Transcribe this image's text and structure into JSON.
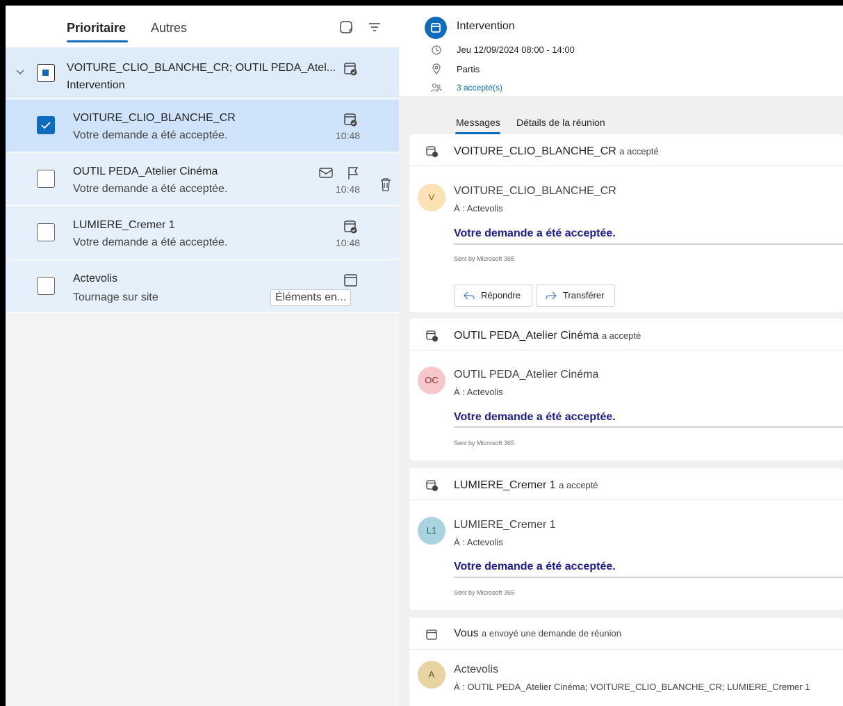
{
  "list_tabs": {
    "focused": "Prioritaire",
    "other": "Autres"
  },
  "threads": [
    {
      "title": "VOITURE_CLIO_BLANCHE_CR; OUTIL PEDA_Atel...",
      "subtitle": "Intervention"
    },
    {
      "title": "VOITURE_CLIO_BLANCHE_CR",
      "subtitle": "Votre demande a été acceptée.",
      "time": "10:48",
      "checked": true
    },
    {
      "title": "OUTIL PEDA_Atelier Cinéma",
      "subtitle": "Votre demande a été acceptée.",
      "time": "10:48",
      "checked": false
    },
    {
      "title": "LUMIERE_Cremer 1",
      "subtitle": "Votre demande a été acceptée.",
      "time": "10:48",
      "checked": false
    },
    {
      "title": "Actevolis",
      "subtitle": "Tournage sur site",
      "tag": "Éléments en...",
      "checked": false
    }
  ],
  "event": {
    "title": "Intervention",
    "datetime": "Jeu 12/09/2024 08:00 - 14:00",
    "location": "Partis",
    "attendees": "3 accepté(s)"
  },
  "message_tabs": {
    "messages": "Messages",
    "details": "Détails de la réunion"
  },
  "messages": [
    {
      "who": "VOITURE_CLIO_BLANCHE_CR",
      "action": "a accepté",
      "avatar": "V",
      "avatar_color": "#fce2b4",
      "sender": "VOITURE_CLIO_BLANCHE_CR",
      "to": "À : Actevolis",
      "body": "Votre demande a été acceptée.",
      "footer": "Sent by Microsoft 365"
    },
    {
      "who": "OUTIL PEDA_Atelier Cinéma",
      "action": "a accepté",
      "avatar": "OC",
      "avatar_color": "#f6c8cb",
      "sender": "OUTIL PEDA_Atelier Cinéma",
      "to": "À : Actevolis",
      "body": "Votre demande a été acceptée.",
      "footer": "Sent by Microsoft 365"
    },
    {
      "who": "LUMIERE_Cremer 1",
      "action": "a accepté",
      "avatar": "L1",
      "avatar_color": "#a9d3df",
      "sender": "LUMIERE_Cremer 1",
      "to": "À : Actevolis",
      "body": "Votre demande a été acceptée.",
      "footer": "Sent by Microsoft 365"
    },
    {
      "who": "Vous",
      "action": "a envoyé une demande de réunion",
      "avatar": "A",
      "avatar_color": "#e8d4a3",
      "sender": "Actevolis",
      "to": "À : OUTIL PEDA_Atelier Cinéma;  VOITURE_CLIO_BLANCHE_CR;  LUMIERE_Cremer 1"
    }
  ],
  "actions": {
    "reply": "Répondre",
    "forward": "Transférer"
  }
}
